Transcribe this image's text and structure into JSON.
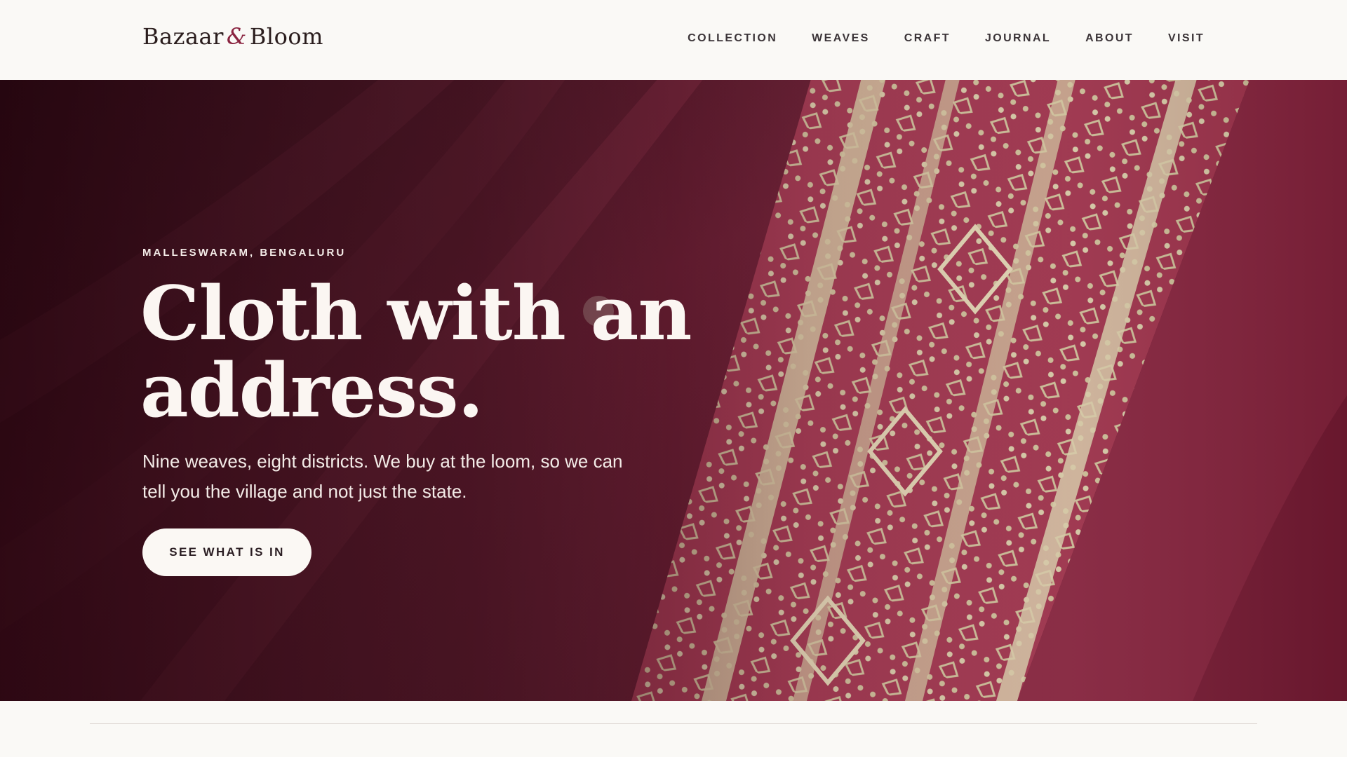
{
  "header": {
    "logo_left": "Bazaar",
    "logo_amp": "&",
    "logo_right": "Bloom",
    "nav": [
      "COLLECTION",
      "WEAVES",
      "CRAFT",
      "JOURNAL",
      "ABOUT",
      "VISIT"
    ]
  },
  "hero": {
    "eyebrow": "MALLESWARAM, BENGALURU",
    "headline_line1": "Cloth with an",
    "headline_line2": "address.",
    "lede": "Nine weaves, eight districts. We buy at the loom, so we can tell you the village and not just the state.",
    "cta_label": "SEE WHAT IS IN"
  },
  "colors": {
    "page_background": "#faf9f6",
    "brand_accent": "#8a2440",
    "fabric_red": "#7a1a34",
    "zari_gold": "#d9c9a0"
  }
}
